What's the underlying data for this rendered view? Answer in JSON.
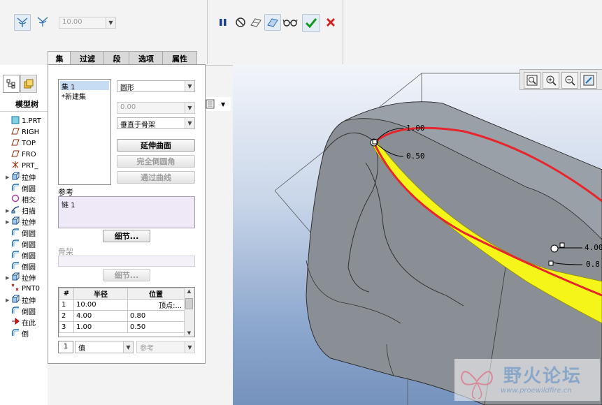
{
  "toolbar": {
    "radius_value": "10.00",
    "pause_icon": "pause-icon",
    "no_preview_icon": "no-preview-icon",
    "verify_icon": "verify-glasses-icon",
    "ok_icon": "checkmark-icon",
    "cancel_icon": "close-icon"
  },
  "tabs": [
    {
      "label": "集",
      "active": true
    },
    {
      "label": "过滤"
    },
    {
      "label": "段"
    },
    {
      "label": "选项"
    },
    {
      "label": "属性"
    }
  ],
  "sets_panel": {
    "sets": [
      "集 1",
      "*新建集"
    ],
    "shape_select": "圆形",
    "disabled_value": "0.00",
    "method_select": "垂直于骨架",
    "btn_extend": "延伸曲面",
    "btn_full_round": "完全倒圆角",
    "btn_through_curve": "通过曲线",
    "references_label": "参考",
    "references_item": "链 1",
    "details_btn": "细节...",
    "skeleton_label": "骨架",
    "skeleton_details_btn": "细节...",
    "table": {
      "headers": [
        "#",
        "半径",
        "位置"
      ],
      "rows": [
        [
          "1",
          "10.00",
          "顶点:..."
        ],
        [
          "2",
          "4.00",
          "0.80"
        ],
        [
          "3",
          "1.00",
          "0.50"
        ]
      ]
    },
    "footer_index": "1",
    "value_select": "值",
    "reference_select": "参考"
  },
  "model_tree": {
    "tab_label": "模型树",
    "items": [
      {
        "label": "1.PRT",
        "icon": "part-icon"
      },
      {
        "label": "RIGH",
        "icon": "datum-plane-icon"
      },
      {
        "label": "TOP",
        "icon": "datum-plane-icon"
      },
      {
        "label": "FRO",
        "icon": "datum-plane-icon"
      },
      {
        "label": "PRT_",
        "icon": "coordinate-system-icon"
      },
      {
        "label": "拉伸",
        "icon": "extrude-icon"
      },
      {
        "label": "倒圆",
        "icon": "round-icon"
      },
      {
        "label": "相交",
        "icon": "intersect-icon"
      },
      {
        "label": "扫描",
        "icon": "sweep-icon"
      },
      {
        "label": "拉伸",
        "icon": "extrude-icon"
      },
      {
        "label": "倒圆",
        "icon": "round-icon"
      },
      {
        "label": "倒圆",
        "icon": "round-icon"
      },
      {
        "label": "倒圆",
        "icon": "round-icon"
      },
      {
        "label": "倒圆",
        "icon": "round-icon"
      },
      {
        "label": "拉伸",
        "icon": "extrude-icon"
      },
      {
        "label": "PNT0",
        "icon": "datum-point-icon"
      },
      {
        "label": "拉伸",
        "icon": "extrude-icon"
      },
      {
        "label": "倒圆",
        "icon": "round-icon"
      },
      {
        "label": "在此",
        "icon": "insert-here-icon"
      },
      {
        "label": "倒",
        "icon": "round-icon"
      }
    ]
  },
  "viewport": {
    "dims": {
      "d1": "1.00",
      "d2": "0.50",
      "d3": "4.00",
      "d4": "0.8"
    },
    "accent_red": "#e8242c",
    "accent_yellow": "#f5f51a",
    "model_color": "#8a8f96"
  },
  "watermark": {
    "title": "野火论坛",
    "url": "www.proewildfire.cn"
  }
}
